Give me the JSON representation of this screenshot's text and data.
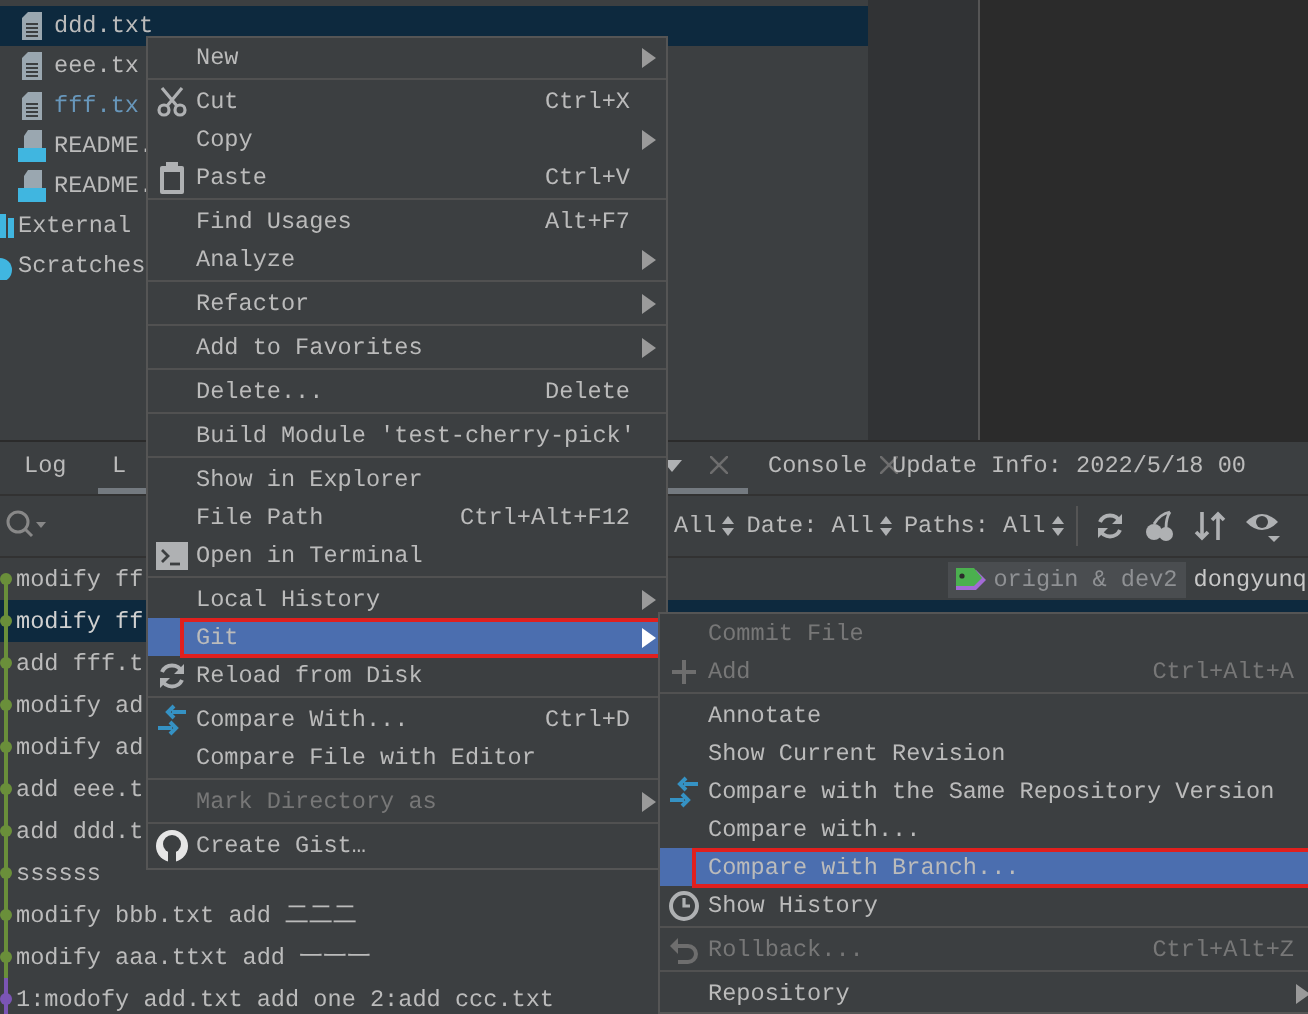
{
  "project_tree": {
    "items": [
      {
        "kind": "text",
        "label": "ddd.txt",
        "selected": true,
        "modified": false
      },
      {
        "kind": "text",
        "label": "eee.tx",
        "selected": false,
        "modified": false
      },
      {
        "kind": "text",
        "label": "fff.tx",
        "selected": false,
        "modified": true
      },
      {
        "kind": "markdown",
        "label": "README.",
        "selected": false,
        "modified": false
      },
      {
        "kind": "markdown",
        "label": "README.",
        "selected": false,
        "modified": false
      },
      {
        "kind": "library",
        "label": "External",
        "selected": false,
        "modified": false
      },
      {
        "kind": "scratches",
        "label": "Scratches",
        "selected": false,
        "modified": false
      }
    ]
  },
  "bottom_panel": {
    "tabs": [
      {
        "label": "Log",
        "selected": false,
        "dropdown": false,
        "closable": false
      },
      {
        "label": "L",
        "selected": true,
        "dropdown": true,
        "closable": true
      },
      {
        "label": "Console",
        "selected": false,
        "dropdown": false,
        "closable": true
      },
      {
        "label": "Update Info: 2022/5/18 00",
        "selected": false,
        "dropdown": false,
        "closable": false
      }
    ],
    "filters": [
      {
        "label": "All"
      },
      {
        "label": "Date: All"
      },
      {
        "label": "Paths: All"
      }
    ],
    "log_rows": [
      {
        "message": "modify ff",
        "selected": false,
        "color": "#6a8f3a",
        "refs": "origin & dev2",
        "author": "dongyunq"
      },
      {
        "message": "modify ff",
        "selected": true,
        "color": "#6a8f3a"
      },
      {
        "message": "add fff.t",
        "selected": false,
        "color": "#6a8f3a"
      },
      {
        "message": "modify ad",
        "selected": false,
        "color": "#6a8f3a"
      },
      {
        "message": "modify ad",
        "selected": false,
        "color": "#6a8f3a"
      },
      {
        "message": "add eee.t",
        "selected": false,
        "color": "#6a8f3a"
      },
      {
        "message": "add ddd.t",
        "selected": false,
        "color": "#6a8f3a"
      },
      {
        "message": "ssssss",
        "selected": false,
        "color": "#6a8f3a"
      },
      {
        "message": "modify bbb.txt add 二二二",
        "selected": false,
        "color": "#6a8f3a"
      },
      {
        "message": "modify aaa.ttxt add 一一一",
        "selected": false,
        "color": "#6a8f3a"
      },
      {
        "message": "1:modofy add.txt add one 2:add ccc.txt",
        "selected": false,
        "color": "#7b55b5"
      }
    ]
  },
  "context_menu": {
    "items": [
      {
        "kind": "item",
        "label": "New",
        "submenu": true,
        "disabled": false,
        "selected": false,
        "highlighted": false
      },
      {
        "kind": "separator"
      },
      {
        "kind": "item",
        "label": "Cut",
        "shortcut": "Ctrl+X",
        "submenu": false,
        "disabled": false,
        "selected": false,
        "highlighted": false
      },
      {
        "kind": "item",
        "label": "Copy",
        "submenu": true,
        "disabled": false,
        "selected": false,
        "highlighted": false
      },
      {
        "kind": "item",
        "label": "Paste",
        "shortcut": "Ctrl+V",
        "submenu": false,
        "disabled": false,
        "selected": false,
        "highlighted": false
      },
      {
        "kind": "separator"
      },
      {
        "kind": "item",
        "label": "Find Usages",
        "shortcut": "Alt+F7",
        "submenu": false,
        "disabled": false,
        "selected": false,
        "highlighted": false
      },
      {
        "kind": "item",
        "label": "Analyze",
        "submenu": true,
        "disabled": false,
        "selected": false,
        "highlighted": false
      },
      {
        "kind": "separator"
      },
      {
        "kind": "item",
        "label": "Refactor",
        "submenu": true,
        "disabled": false,
        "selected": false,
        "highlighted": false
      },
      {
        "kind": "separator"
      },
      {
        "kind": "item",
        "label": "Add to Favorites",
        "submenu": true,
        "disabled": false,
        "selected": false,
        "highlighted": false
      },
      {
        "kind": "separator"
      },
      {
        "kind": "item",
        "label": "Delete...",
        "shortcut": "Delete",
        "submenu": false,
        "disabled": false,
        "selected": false,
        "highlighted": false
      },
      {
        "kind": "separator"
      },
      {
        "kind": "item",
        "label": "Build Module 'test-cherry-pick'",
        "submenu": false,
        "disabled": false,
        "selected": false,
        "highlighted": false
      },
      {
        "kind": "separator"
      },
      {
        "kind": "item",
        "label": "Show in Explorer",
        "submenu": false,
        "disabled": false,
        "selected": false,
        "highlighted": false
      },
      {
        "kind": "item",
        "label": "File Path",
        "shortcut": "Ctrl+Alt+F12",
        "submenu": false,
        "disabled": false,
        "selected": false,
        "highlighted": false
      },
      {
        "kind": "item",
        "label": "Open in Terminal",
        "submenu": false,
        "disabled": false,
        "selected": false,
        "highlighted": false
      },
      {
        "kind": "separator"
      },
      {
        "kind": "item",
        "label": "Local History",
        "submenu": true,
        "disabled": false,
        "selected": false,
        "highlighted": false
      },
      {
        "kind": "item",
        "label": "Git",
        "submenu": true,
        "disabled": false,
        "selected": true,
        "highlighted": true
      },
      {
        "kind": "item",
        "label": "Reload from Disk",
        "submenu": false,
        "disabled": false,
        "selected": false,
        "highlighted": false
      },
      {
        "kind": "separator"
      },
      {
        "kind": "item",
        "label": "Compare With...",
        "shortcut": "Ctrl+D",
        "submenu": false,
        "disabled": false,
        "selected": false,
        "highlighted": false
      },
      {
        "kind": "item",
        "label": "Compare File with Editor",
        "submenu": false,
        "disabled": false,
        "selected": false,
        "highlighted": false
      },
      {
        "kind": "separator"
      },
      {
        "kind": "item",
        "label": "Mark Directory as",
        "submenu": true,
        "disabled": true,
        "selected": false,
        "highlighted": false
      },
      {
        "kind": "separator"
      },
      {
        "kind": "item",
        "label": "Create Gist…",
        "submenu": false,
        "disabled": false,
        "selected": false,
        "highlighted": false
      }
    ]
  },
  "git_submenu": {
    "items": [
      {
        "kind": "item",
        "label": "Commit File",
        "submenu": false,
        "disabled": true,
        "selected": false,
        "highlighted": false
      },
      {
        "kind": "item",
        "label": "Add",
        "shortcut": "Ctrl+Alt+A",
        "submenu": false,
        "disabled": true,
        "selected": false,
        "highlighted": false
      },
      {
        "kind": "separator"
      },
      {
        "kind": "item",
        "label": "Annotate",
        "submenu": false,
        "disabled": false,
        "selected": false,
        "highlighted": false
      },
      {
        "kind": "item",
        "label": "Show Current Revision",
        "submenu": false,
        "disabled": false,
        "selected": false,
        "highlighted": false
      },
      {
        "kind": "item",
        "label": "Compare with the Same Repository Version",
        "submenu": false,
        "disabled": false,
        "selected": false,
        "highlighted": false
      },
      {
        "kind": "item",
        "label": "Compare with...",
        "submenu": false,
        "disabled": false,
        "selected": false,
        "highlighted": false
      },
      {
        "kind": "item",
        "label": "Compare with Branch...",
        "submenu": false,
        "disabled": false,
        "selected": true,
        "highlighted": true
      },
      {
        "kind": "item",
        "label": "Show History",
        "submenu": false,
        "disabled": false,
        "selected": false,
        "highlighted": false
      },
      {
        "kind": "separator"
      },
      {
        "kind": "item",
        "label": "Rollback...",
        "shortcut": "Ctrl+Alt+Z",
        "submenu": false,
        "disabled": true,
        "selected": false,
        "highlighted": false
      },
      {
        "kind": "separator"
      },
      {
        "kind": "item",
        "label": "Repository",
        "submenu": true,
        "disabled": false,
        "selected": false,
        "highlighted": false
      }
    ]
  }
}
